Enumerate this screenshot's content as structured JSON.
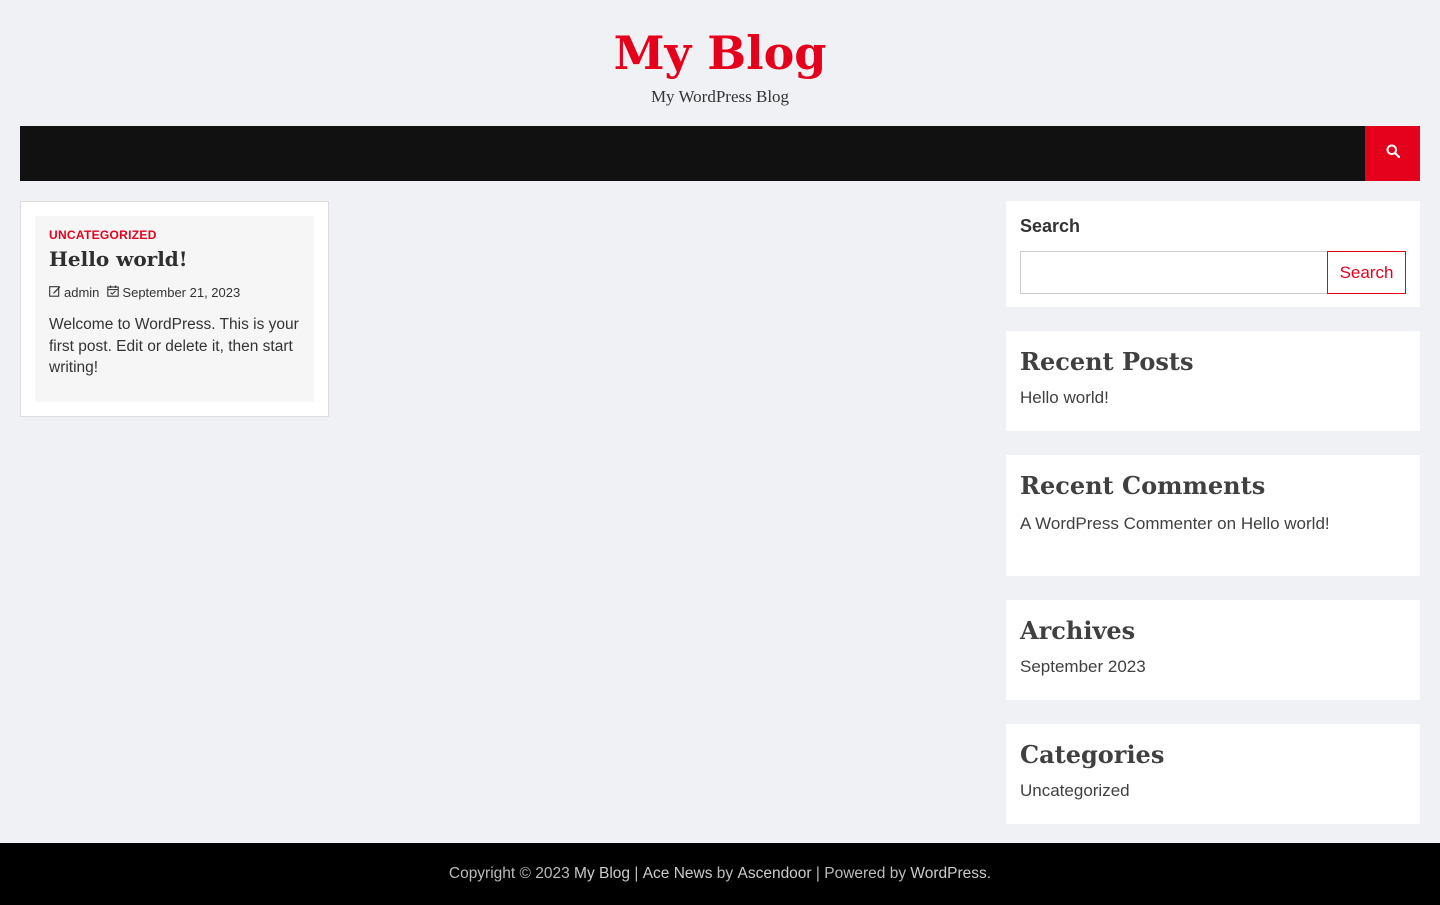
{
  "header": {
    "site_title": "My Blog",
    "site_description": "My WordPress Blog"
  },
  "nav": {
    "search_icon": "search-icon"
  },
  "post": {
    "category": "Uncategorized",
    "title": "Hello world!",
    "author_icon": "edit-icon",
    "author": "admin",
    "date_icon": "calendar-icon",
    "date": "September 21, 2023",
    "excerpt": "Welcome to WordPress. This is your first post. Edit or delete it, then start writing!"
  },
  "sidebar": {
    "search": {
      "label": "Search",
      "placeholder": "",
      "button_label": "Search"
    },
    "recent_posts": {
      "title": "Recent Posts",
      "items": [
        "Hello world!"
      ]
    },
    "recent_comments": {
      "title": "Recent Comments",
      "author": "A WordPress Commenter",
      "on_text": "on",
      "post": "Hello world!"
    },
    "archives": {
      "title": "Archives",
      "items": [
        "September 2023"
      ]
    },
    "categories": {
      "title": "Categories",
      "items": [
        "Uncategorized"
      ]
    }
  },
  "footer": {
    "copyright": "Copyright © 2023",
    "site_link": "My Blog",
    "sep1": "|",
    "theme_link": "Ace News",
    "by_text": "by",
    "author_link": "Ascendoor",
    "sep2": "|",
    "powered_text": "Powered by",
    "wp_link": "WordPress",
    "end": "."
  },
  "colors": {
    "accent": "#e5001b",
    "nav_bg": "#111111",
    "page_bg": "#f0f1f5",
    "footer_bg": "#000000"
  }
}
